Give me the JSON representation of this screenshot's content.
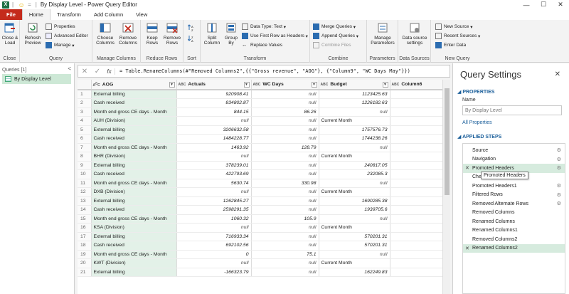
{
  "titlebar": {
    "separator": "|",
    "title": "By Display Level - Power Query Editor"
  },
  "ribbon_tabs": [
    "File",
    "Home",
    "Transform",
    "Add Column",
    "View"
  ],
  "ribbon": {
    "close": {
      "btn": "Close &",
      "btn2": "Load",
      "label": "Close"
    },
    "query": {
      "refresh": "Refresh",
      "refresh2": "Preview",
      "properties": "Properties",
      "adv_editor": "Advanced Editor",
      "manage": "Manage",
      "label": "Query"
    },
    "manage_columns": {
      "choose": "Choose",
      "choose2": "Columns",
      "remove": "Remove",
      "remove2": "Columns",
      "label": "Manage Columns"
    },
    "reduce_rows": {
      "keep": "Keep",
      "keep2": "Rows",
      "remove": "Remove",
      "remove2": "Rows",
      "label": "Reduce Rows"
    },
    "sort": {
      "label": "Sort"
    },
    "transform": {
      "split": "Split",
      "split2": "Column",
      "group": "Group",
      "group2": "By",
      "datatype": "Data Type: Text",
      "first_row": "Use First Row as Headers",
      "replace": "Replace Values",
      "label": "Transform"
    },
    "combine": {
      "merge": "Merge Queries",
      "append": "Append Queries",
      "files": "Combine Files",
      "label": "Combine"
    },
    "parameters": {
      "manage": "Manage",
      "manage2": "Parameters",
      "label": "Parameters"
    },
    "data_sources": {
      "settings": "Data source",
      "settings2": "settings",
      "label": "Data Sources"
    },
    "new_query": {
      "new_source": "New Source",
      "recent": "Recent Sources",
      "enter": "Enter Data",
      "label": "New Query"
    }
  },
  "queries": {
    "header": "Queries [1]",
    "collapse": "<",
    "items": [
      "By Display Level"
    ]
  },
  "formula": {
    "cancel": "✕",
    "commit": "✓",
    "fx": "fx",
    "text": "= Table.RenameColumns(#\"Removed Columns2\",{{\"Gross revenue\", \"AOG\"}, {\"Column9\", \"WC Days May\"}})"
  },
  "columns": [
    {
      "type": "ABC\n123",
      "name": "AOG"
    },
    {
      "type": "ABC\n123",
      "name": "Actuals"
    },
    {
      "type": "ABC\n123",
      "name": "WC Days"
    },
    {
      "type": "ABC\n123",
      "name": "Budget"
    },
    {
      "type": "ABC\n123",
      "name": "Column6"
    }
  ],
  "rows": [
    [
      "1",
      "External billing",
      "920908.41",
      "null",
      "1123425.63"
    ],
    [
      "2",
      "Cash received",
      "834802.87",
      "null",
      "1226182.63"
    ],
    [
      "3",
      "Month end gross CE days - Month",
      "844.15",
      "86.26",
      "null"
    ],
    [
      "4",
      "AUH (Division)",
      "null",
      "null",
      "Current Month"
    ],
    [
      "5",
      "External billing",
      "3206632.58",
      "null",
      "1757576.73"
    ],
    [
      "6",
      "Cash received",
      "1484228.77",
      "null",
      "1744238.26"
    ],
    [
      "7",
      "Month end gross CE days - Month",
      "1463.92",
      "128.79",
      "null"
    ],
    [
      "8",
      "BHR (Division)",
      "null",
      "null",
      "Current Month"
    ],
    [
      "9",
      "External billing",
      "378239.01",
      "null",
      "240817.05"
    ],
    [
      "10",
      "Cash received",
      "422793.69",
      "null",
      "232085.3"
    ],
    [
      "11",
      "Month end gross CE days - Month",
      "5630.74",
      "330.98",
      "null"
    ],
    [
      "12",
      "DXB (Division)",
      "null",
      "null",
      "Current Month"
    ],
    [
      "13",
      "External billing",
      "1262845.27",
      "null",
      "1690285.38"
    ],
    [
      "14",
      "Cash received",
      "2598291.35",
      "null",
      "1939705.6"
    ],
    [
      "15",
      "Month end gross CE days - Month",
      "1060.32",
      "105.9",
      "null"
    ],
    [
      "16",
      "KSA (Division)",
      "null",
      "null",
      "Current Month"
    ],
    [
      "17",
      "External billing",
      "716933.34",
      "null",
      "570201.31"
    ],
    [
      "18",
      "Cash received",
      "692102.56",
      "null",
      "570201.31"
    ],
    [
      "19",
      "Month end gross CE days - Month",
      "0",
      "75.1",
      "null"
    ],
    [
      "20",
      "KWT (Division)",
      "null",
      "null",
      "Current Month"
    ],
    [
      "21",
      "External billing",
      "-166323.79",
      "null",
      "162249.83"
    ]
  ],
  "settings": {
    "title": "Query Settings",
    "close": "✕",
    "properties_head": "PROPERTIES",
    "name_label": "Name",
    "name_value": "By Display Level",
    "all_props": "All Properties",
    "steps_head": "APPLIED STEPS",
    "steps": [
      {
        "name": "Source",
        "x": false,
        "gear": true
      },
      {
        "name": "Navigation",
        "x": false,
        "gear": true
      },
      {
        "name": "Promoted Headers",
        "x": true,
        "gear": true,
        "sel": true
      },
      {
        "name": "Che",
        "x": false,
        "gear": false
      },
      {
        "name": "Promoted Headers1",
        "x": false,
        "gear": true
      },
      {
        "name": "Filtered Rows",
        "x": false,
        "gear": true
      },
      {
        "name": "Removed Alternate Rows",
        "x": false,
        "gear": true
      },
      {
        "name": "Removed Columns",
        "x": false,
        "gear": false
      },
      {
        "name": "Renamed Columns",
        "x": false,
        "gear": false
      },
      {
        "name": "Renamed Columns1",
        "x": false,
        "gear": false
      },
      {
        "name": "Removed Columns2",
        "x": false,
        "gear": false
      },
      {
        "name": "Renamed Columns2",
        "x": true,
        "gear": false,
        "sel": true
      }
    ],
    "tooltip": "Promoted Headers"
  }
}
